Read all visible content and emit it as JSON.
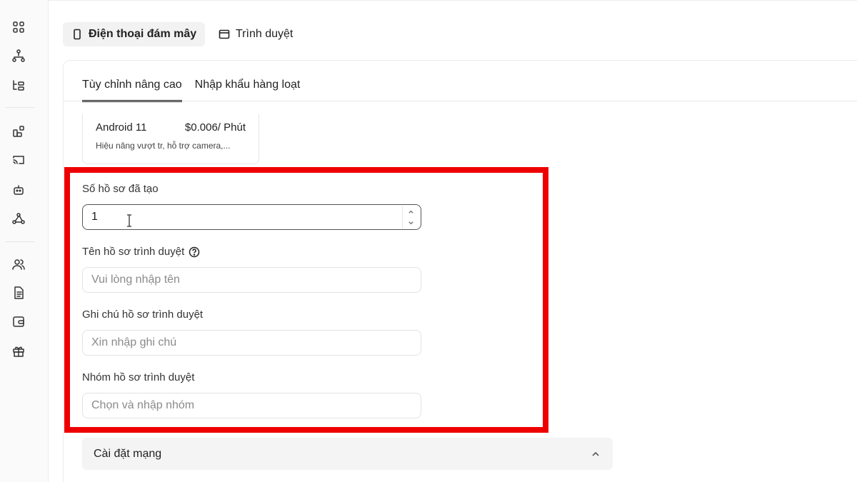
{
  "top_tabs": {
    "cloud_phone": "Điện thoại đám mây",
    "browser": "Trình duyệt"
  },
  "sub_tabs": {
    "advanced": "Tùy chỉnh nâng cao",
    "bulk_import": "Nhập khẩu hàng loạt"
  },
  "plan": {
    "name": "Android 11",
    "price": "$0.006/ Phút",
    "desc": "Hiệu năng vượt tr, hỗ trợ camera,..."
  },
  "form": {
    "count_label": "Số hồ sơ đã tạo",
    "count_value": "1",
    "name_label": "Tên hồ sơ trình duyệt",
    "name_placeholder": "Vui lòng nhập tên",
    "note_label": "Ghi chú hồ sơ trình duyệt",
    "note_placeholder": "Xin nhập ghi chú",
    "group_label": "Nhóm hồ sơ trình duyệt",
    "group_placeholder": "Chọn và nhập nhóm"
  },
  "network": {
    "label": "Cài đặt mạng"
  },
  "colors": {
    "highlight": "#ee0000"
  },
  "icons": {
    "sidebar": [
      "grid-icon",
      "sitemap-icon",
      "tree-icon",
      "apps-icon",
      "cast-icon",
      "robot-icon",
      "webhook-icon",
      "users-icon",
      "document-icon",
      "wallet-icon",
      "gift-icon"
    ]
  }
}
